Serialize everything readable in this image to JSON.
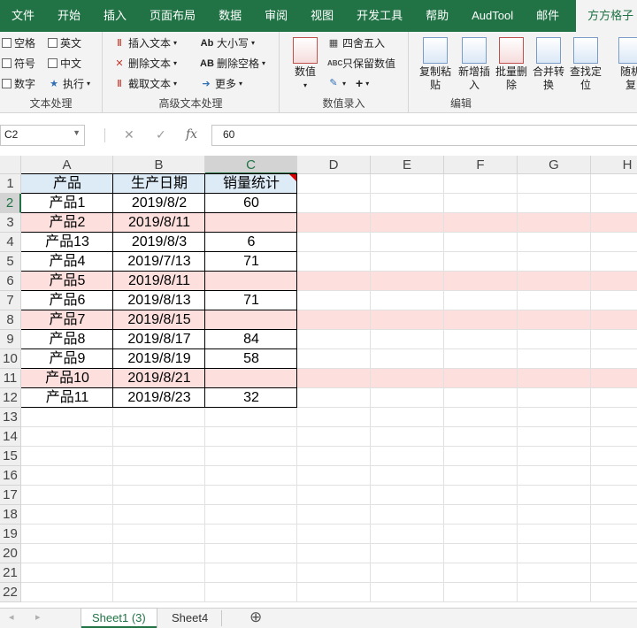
{
  "ribbon_tabs": [
    "文件",
    "开始",
    "插入",
    "页面布局",
    "数据",
    "审阅",
    "视图",
    "开发工具",
    "帮助",
    "AudTool",
    "邮件",
    "方方格子"
  ],
  "active_tab": "方方格子",
  "groups": {
    "text_process": {
      "name": "文本处理",
      "items": [
        "空格",
        "英文",
        "符号",
        "中文",
        "数字",
        "执行"
      ]
    },
    "adv_text": {
      "name": "高级文本处理",
      "items": [
        "插入文本",
        "大小写",
        "删除文本",
        "删除空格",
        "截取文本",
        "更多"
      ]
    },
    "num_entry": {
      "name": "数值录入",
      "big": "数值",
      "items": [
        "四舍五入",
        "只保留数值"
      ]
    },
    "edit": {
      "name": "编辑",
      "buttons": [
        "复制粘贴",
        "新增插入",
        "批量删除",
        "合并转换",
        "查找定位",
        "随机复"
      ]
    }
  },
  "formula_bar": {
    "name_box": "C2",
    "cancel": "✕",
    "enter": "✓",
    "fx": "fx",
    "value": "60"
  },
  "columns": [
    "A",
    "B",
    "C",
    "D",
    "E",
    "F",
    "G",
    "H"
  ],
  "rows": [
    "1",
    "2",
    "3",
    "4",
    "5",
    "6",
    "7",
    "8",
    "9",
    "10",
    "11",
    "12",
    "13",
    "14",
    "15",
    "16",
    "17",
    "18",
    "19",
    "20",
    "21",
    "22"
  ],
  "table": {
    "headers": [
      "产品",
      "生产日期",
      "销量统计"
    ],
    "rows": [
      [
        "产品1",
        "2019/8/2",
        "60"
      ],
      [
        "产品2",
        "2019/8/11",
        ""
      ],
      [
        "产品13",
        "2019/8/3",
        "6"
      ],
      [
        "产品4",
        "2019/7/13",
        "71"
      ],
      [
        "产品5",
        "2019/8/11",
        ""
      ],
      [
        "产品6",
        "2019/8/13",
        "71"
      ],
      [
        "产品7",
        "2019/8/15",
        ""
      ],
      [
        "产品8",
        "2019/8/17",
        "84"
      ],
      [
        "产品9",
        "2019/8/19",
        "58"
      ],
      [
        "产品10",
        "2019/8/21",
        ""
      ],
      [
        "产品11",
        "2019/8/23",
        "32"
      ]
    ]
  },
  "highlight_rows": [
    3,
    6,
    8,
    11
  ],
  "colors": {
    "accent": "#217346",
    "band": "#fde0de",
    "header_fill": "#ddebf7"
  },
  "sheets": [
    "Sheet1 (3)",
    "Sheet4"
  ],
  "active_sheet": "Sheet1 (3)",
  "add_sheet": "⊕"
}
